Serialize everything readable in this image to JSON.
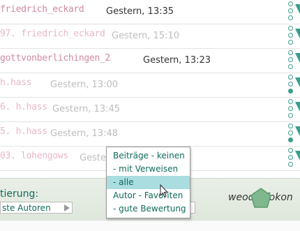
{
  "posts": [
    {
      "author": "friedrich_eckard",
      "stamp": "Gestern, 13:35",
      "faded": false,
      "dots": [
        false,
        false,
        false
      ]
    },
    {
      "author": "97. friedrich_eckard",
      "stamp": "Gestern, 15:10",
      "faded": true,
      "dots": [
        false,
        false,
        false
      ]
    },
    {
      "author": "gottvonberlichingen_2",
      "stamp": "Gestern, 13:23",
      "faded": false,
      "dots": [
        false,
        false,
        false
      ]
    },
    {
      "author": "h.hass",
      "stamp": "Gestern, 13:00",
      "faded": true,
      "dots": [
        false,
        false,
        true
      ]
    },
    {
      "author": "6. h.hass",
      "stamp": "Gestern, 13:45",
      "faded": true,
      "dots": [
        false,
        false,
        false
      ]
    },
    {
      "author": "5. h.hass",
      "stamp": "Gestern, 13:48",
      "faded": true,
      "dots": [
        false,
        false,
        true
      ]
    },
    {
      "author": "03. lohengows",
      "stamp": "Gestern",
      "faded": true,
      "dots": [
        false,
        false,
        false
      ]
    }
  ],
  "sort": {
    "label": "tierung:",
    "value": "ste Autoren"
  },
  "menu": {
    "items": [
      "Beiträge - keinen",
      "- mit Verweisen",
      "- alle",
      "Autor - Favoriten",
      "- gute Bewertung"
    ],
    "selected_index": 2
  },
  "brand": "weodis-fokon",
  "colors": {
    "accent": "#3a9e8c",
    "author": "#d08aa0",
    "menu_text": "#0f6a5b",
    "selection": "#a9dde0"
  }
}
